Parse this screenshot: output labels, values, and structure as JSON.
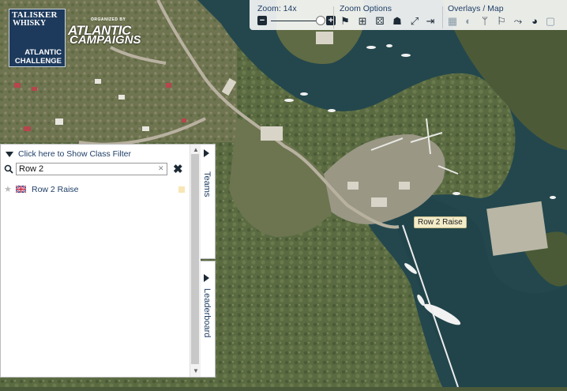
{
  "logo": {
    "brand_line1": "TALISKER",
    "brand_line2": "WHISKY",
    "event_line1": "ATLANTIC",
    "event_line2": "CHALLENGE"
  },
  "organizer": {
    "small_text": "ORGANIZED BY",
    "name_line1": "ATLANTIC",
    "name_line2": "CAMPAIGNS"
  },
  "toolbar": {
    "zoom_label": "Zoom: 14x",
    "zoom_level": 14,
    "zoom_options_label": "Zoom Options",
    "overlays_label": "Overlays / Map",
    "minus": "−",
    "plus": "+"
  },
  "panel": {
    "filter_label": "Click here to Show Class Filter",
    "search_value": "Row 2",
    "results": [
      {
        "name": "Row 2 Raise",
        "flag": "uk-flag-icon",
        "favorite": false
      }
    ]
  },
  "tabs": {
    "teams": "Teams",
    "leaderboard": "Leaderboard"
  },
  "map": {
    "boat_label": "Row 2 Raise"
  },
  "colors": {
    "accent_text": "#1f3e66",
    "toolbar_icon": "#1c2a36",
    "label_bg": "#f3ecc9",
    "logo_bg": "#1d3a5c"
  }
}
